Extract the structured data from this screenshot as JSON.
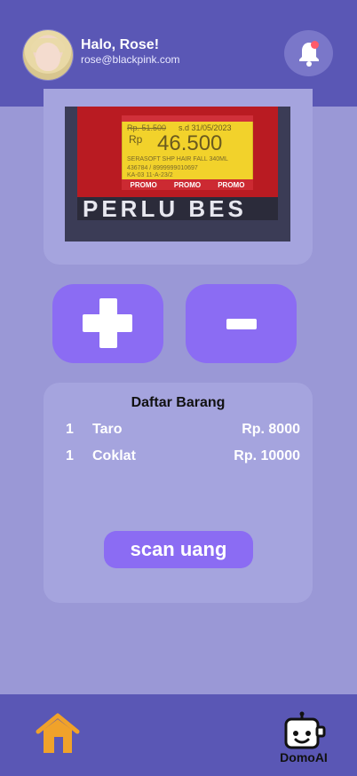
{
  "header": {
    "greeting": "Halo, Rose!",
    "email": "rose@blackpink.com",
    "notification_icon": "bell-icon"
  },
  "scan_preview": {
    "price_tag": {
      "old_price": "Rp. 51.500",
      "date": "s.d 31/05/2023",
      "currency": "Rp",
      "price": "46.500",
      "details_line1": "SERASOFT SHP HAIR FALL 340ML",
      "details_line2": "436784 / 8999999010697",
      "details_line3": "KA-03 11-A-23/2",
      "promo_words": [
        "PROMO",
        "PROMO",
        "PROMO"
      ]
    },
    "background_text": "PERLU BES"
  },
  "controls": {
    "add_icon": "plus-icon",
    "remove_icon": "minus-icon"
  },
  "list": {
    "title": "Daftar Barang",
    "items": [
      {
        "qty": "1",
        "name": "Taro",
        "price": "Rp. 8000"
      },
      {
        "qty": "1",
        "name": "Coklat",
        "price": "Rp. 10000"
      }
    ],
    "scan_button": "scan uang"
  },
  "bottom_nav": {
    "home_icon": "home-icon",
    "assistant_icon": "robot-icon",
    "assistant_label": "DomoAI"
  },
  "colors": {
    "header_bg": "#5a57b5",
    "page_bg": "#9a98d6",
    "card_bg": "#a5a4de",
    "accent": "#8b6cf3",
    "home_orange": "#f0a22a"
  }
}
